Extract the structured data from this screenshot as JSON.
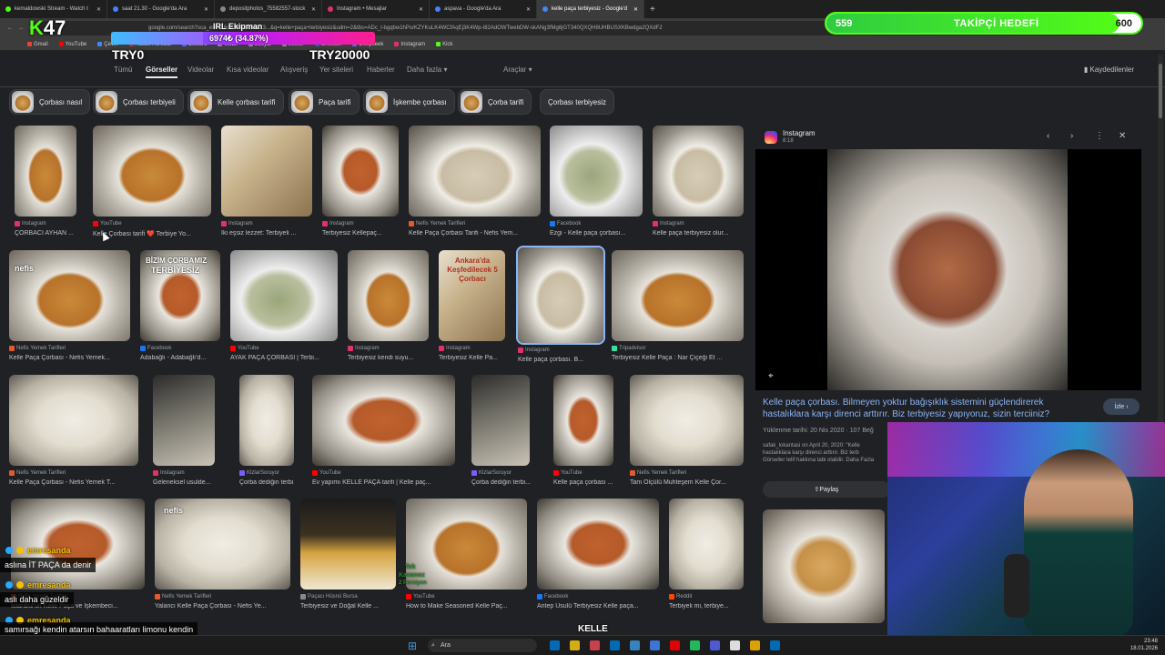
{
  "browser": {
    "tabs": [
      {
        "label": "kemaldowski Stream - Watch t",
        "color": "#53fc18"
      },
      {
        "label": "saat 21.30 - Google'da Ara",
        "color": "#4285f4"
      },
      {
        "label": "depositphotos_75582557-stock",
        "color": "#888888"
      },
      {
        "label": "Instagram • Mesajlar",
        "color": "#e1306c"
      },
      {
        "label": "aspava - Google'da Ara",
        "color": "#4285f4"
      },
      {
        "label": "kelle paça terbiyesiz - Google'd",
        "color": "#4285f4"
      }
    ],
    "new_tab": "+",
    "url": "google.com/search?sca_esv=16c82b472cda813...&q=kelle+paça+terbiyesiz&udm=2&tbs=ADc_l-bgqbw1hPsrKZYKuLK4WCfAqEj3K4Wp-I82AdOWTwebDW-skANg3fMg6jGT340QXQH8UHBUSXKBwdga2QXdF2",
    "bookmarks": [
      {
        "label": "Gmail",
        "color": "#ea4335"
      },
      {
        "label": "YouTube",
        "color": "#ff0000"
      },
      {
        "label": "Çeviri",
        "color": "#4285f4"
      },
      {
        "label": "Adobe Acrobat",
        "color": "#d9251d"
      },
      {
        "label": "Diskord",
        "color": "#5865f2"
      },
      {
        "label": "Mobil",
        "color": "#888888"
      },
      {
        "label": "Sosyal",
        "color": "#888888"
      },
      {
        "label": "Siteler",
        "color": "#888888"
      },
      {
        "label": "LinkedIn",
        "color": "#0a66c2"
      },
      {
        "label": "Deepseek",
        "color": "#4d6bfe"
      },
      {
        "label": "Instagram",
        "color": "#e1306c"
      },
      {
        "label": "Kick",
        "color": "#53fc18"
      }
    ]
  },
  "google": {
    "nav_tabs": [
      "Tümü",
      "Görseller",
      "Videolar",
      "Kısa videolar",
      "Alışveriş",
      "Yer siteleri",
      "Haberler",
      "Daha fazla ▾",
      "Araçlar ▾"
    ],
    "active_tab": "Görseller",
    "saved": "Kaydedilenler",
    "chips": [
      "Çorbası nasıl",
      "Çorbası terbiyeli",
      "Kelle çorbası tarifi",
      "Paça tarifi",
      "İşkembe çorbası",
      "Çorba tarifi",
      "Çorbası terbiyesiz"
    ],
    "results": [
      {
        "source": "Instagram",
        "icon_color": "#e1306c",
        "title": "ÇORBACI AYHAN ..."
      },
      {
        "source": "YouTube",
        "icon_color": "#ff0000",
        "title": "Kelle Çorbası tarifi ❤️ Terbiye Yo..."
      },
      {
        "source": "Instagram",
        "icon_color": "#e1306c",
        "title": "İki eşsiz lezzet: Terbiyeli ..."
      },
      {
        "source": "Instagram",
        "icon_color": "#e1306c",
        "title": "Terbiyesiz Kellepaç..."
      },
      {
        "source": "Nefis Yemek Tarifleri",
        "icon_color": "#e25b2c",
        "title": "Kelle Paça Çorbası Tarifi - Nefis Yem..."
      },
      {
        "source": "Facebook",
        "icon_color": "#1877f2",
        "title": "Ezgi - Kelle paça çorbası..."
      },
      {
        "source": "Instagram",
        "icon_color": "#e1306c",
        "title": "Kelle paça terbiyesiz olur..."
      },
      {
        "source": "Nefis Yemek Tarifleri",
        "icon_color": "#e25b2c",
        "title": "Kelle Paça Çorbası - Nefis Yemek..."
      },
      {
        "source": "Facebook",
        "icon_color": "#1877f2",
        "title": "Adabağlı - Adabağlı'd..."
      },
      {
        "source": "YouTube",
        "icon_color": "#ff0000",
        "title": "AYAK PAÇA ÇORBASI | Terbi..."
      },
      {
        "source": "Instagram",
        "icon_color": "#e1306c",
        "title": "Terbiyesiz kendi suyu..."
      },
      {
        "source": "Instagram",
        "icon_color": "#e1306c",
        "title": "Terbiyesiz Kelle Pa..."
      },
      {
        "source": "Instagram",
        "icon_color": "#e1306c",
        "title": "Kelle paça çorbası. B..."
      },
      {
        "source": "Tripadvisor",
        "icon_color": "#34e0a1",
        "title": "Terbiyesiz Kelle Paça : Nar Çiçeği Et ..."
      },
      {
        "source": "Nefis Yemek Tarifleri",
        "icon_color": "#e25b2c",
        "title": "Kelle Paça Çorbası - Nefis Yemek T..."
      },
      {
        "source": "Instagram",
        "icon_color": "#e1306c",
        "title": "Geleneksel usulde..."
      },
      {
        "source": "KlzlarSoruyor",
        "icon_color": "#7a5cff",
        "title": "Çorba dediğin terbi..."
      },
      {
        "source": "YouTube",
        "icon_color": "#ff0000",
        "title": "Ev yapımı KELLE PAÇA tarifi | Kelle paç..."
      },
      {
        "source": "KlzlarSoruyor",
        "icon_color": "#7a5cff",
        "title": "Çorba dediğin terbi..."
      },
      {
        "source": "YouTube",
        "icon_color": "#ff0000",
        "title": "Kelle paça çorbası ..."
      },
      {
        "source": "Nefis Yemek Tarifleri",
        "icon_color": "#e25b2c",
        "title": "Tam Ölçülü Muhteşem Kelle Çor..."
      },
      {
        "source": "Nefis Yemek Tarifleri",
        "icon_color": "#e25b2c",
        "title": "İstanbul'un Kelle Paça ve İşkembeci..."
      },
      {
        "source": "Nefis Yemek Tarifleri",
        "icon_color": "#e25b2c",
        "title": "Yalancı Kelle Paça Çorbası - Nefis Ye..."
      },
      {
        "source": "Paçacı Hüsnü Bursa",
        "icon_color": "#888888",
        "title": "Terbiyesiz ve Doğal Kelle ..."
      },
      {
        "source": "YouTube",
        "icon_color": "#ff0000",
        "title": "How to Make Seasoned Kelle Paç..."
      },
      {
        "source": "Facebook",
        "icon_color": "#1877f2",
        "title": "Antep Usulü Terbiyesiz Kelle paça..."
      },
      {
        "source": "Reddit",
        "icon_color": "#ff4500",
        "title": "Terbiyeli mi, terbiye..."
      }
    ],
    "image_texts": {
      "bizim_line1": "BİZİM ÇORBAMIZ",
      "bizim_line2": "TERBİYESİZ",
      "ankara": "Ankara'da Keşfedilecek 5 Çorbacı",
      "kavanoz1": "Tek",
      "kavanoz2": "Kavanoz",
      "kavanoz3": "2 Porsiyon",
      "nefis": "nefis",
      "kelle": "KELLE"
    }
  },
  "preview": {
    "source": "Instagram",
    "time": "8:18",
    "description": "Kelle paça çorbası. Bilmeyen yoktur bağışıklık sistemini güçlendirerek hastalıklara karşı direnci arttırır. Biz terbiyesiz yapıyoruz, sizin terciiniz?",
    "watch_button": "İzle ›",
    "meta": "Yüklenme tarihi: 20 Nis 2020 · 107 Beğ",
    "sub_line1": "safak_lokantasi on April 20, 2020: \"Kelle",
    "sub_line2": "hastalıklara karşı direnci arttırır. Biz terb",
    "sub_line3": "Görseller telif hakkına tabi olabilir. Daha Fazla",
    "share_button": "Paylaş",
    "controls": [
      "‹",
      "›",
      "⋮",
      "✕"
    ]
  },
  "stream_overlay": {
    "kick_logo": "K",
    "viewer_count": "47",
    "goal_title": "IRL Ekipman",
    "goal_value": "6974₺ (34.87%)",
    "goal_progress": 0.3487,
    "try_left": "TRY0",
    "try_right": "TRY20000",
    "follower_current": "559",
    "follower_title": "TAKİPÇİ HEDEFİ",
    "follower_target": "600",
    "follower_progress": 0.93
  },
  "chat": [
    {
      "type": "user",
      "name": "emresanda"
    },
    {
      "type": "msg",
      "text": "aslına İT PAÇA da denir"
    },
    {
      "type": "user",
      "name": "emresanda"
    },
    {
      "type": "msg",
      "text": "aslı daha güzeldir"
    },
    {
      "type": "user",
      "name": "emresanda"
    },
    {
      "type": "msg",
      "text": "samırsağı kendin atarsın bahaaratları limonu kendin"
    },
    {
      "type": "msg",
      "text": "atarsın"
    }
  ],
  "taskbar": {
    "search_placeholder": "Ara",
    "time": "23:48",
    "date": "18.01.2026",
    "app_colors": [
      "#0078d4",
      "#f2c811",
      "#e74856",
      "#0078d4",
      "#3a96dd",
      "#4285f4",
      "#ff0000",
      "#25d366",
      "#5865f2",
      "#ffffff",
      "#ffb900",
      "#0078d4"
    ]
  }
}
